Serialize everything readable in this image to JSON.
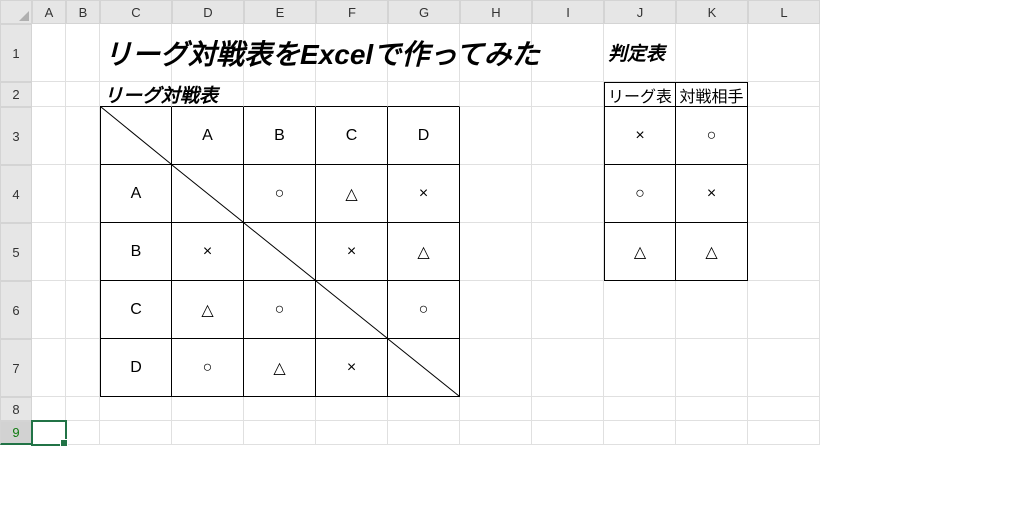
{
  "columns": [
    "A",
    "B",
    "C",
    "D",
    "E",
    "F",
    "G",
    "H",
    "I",
    "J",
    "K",
    "L"
  ],
  "rows": [
    "1",
    "2",
    "3",
    "4",
    "5",
    "6",
    "7",
    "8",
    "9"
  ],
  "title": "リーグ対戦表をExcelで作ってみた",
  "league": {
    "label": "リーグ対戦表",
    "headers": [
      "A",
      "B",
      "C",
      "D"
    ],
    "rows": [
      {
        "name": "A",
        "cells": [
          "",
          "○",
          "△",
          "×"
        ]
      },
      {
        "name": "B",
        "cells": [
          "×",
          "",
          "×",
          "△"
        ]
      },
      {
        "name": "C",
        "cells": [
          "△",
          "○",
          "",
          "○"
        ]
      },
      {
        "name": "D",
        "cells": [
          "○",
          "△",
          "×",
          ""
        ]
      }
    ]
  },
  "judge": {
    "label": "判定表",
    "headers": [
      "リーグ表",
      "対戦相手"
    ],
    "rows": [
      [
        "×",
        "○"
      ],
      [
        "○",
        "×"
      ],
      [
        "△",
        "△"
      ]
    ]
  },
  "selected_row": "9"
}
